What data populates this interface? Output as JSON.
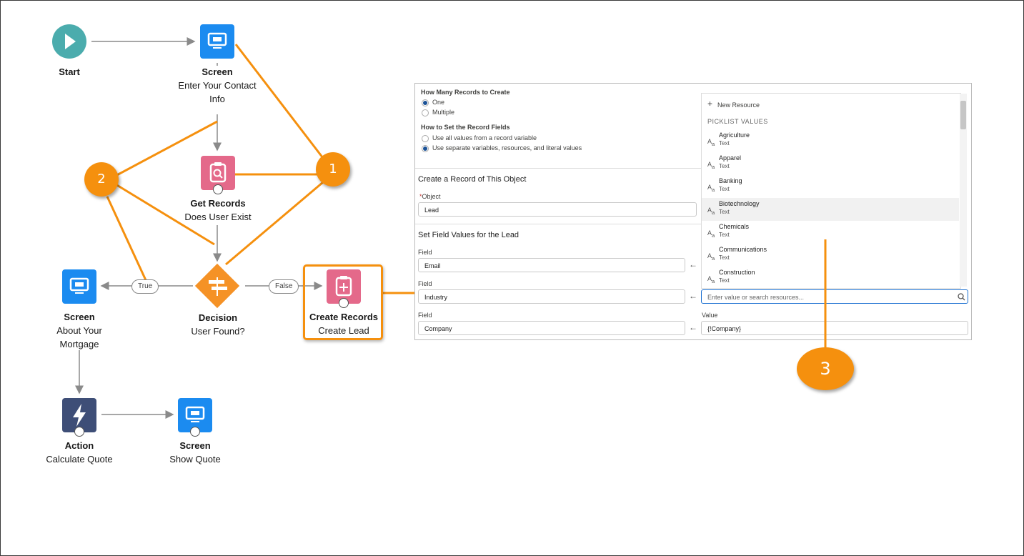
{
  "flow": {
    "start": {
      "label": "Start"
    },
    "screen_contact": {
      "type": "Screen",
      "label": "Enter Your Contact Info"
    },
    "get_records": {
      "type": "Get Records",
      "label": "Does User Exist"
    },
    "decision": {
      "type": "Decision",
      "label": "User Found?"
    },
    "screen_mortgage": {
      "type": "Screen",
      "label": "About Your Mortgage"
    },
    "create_records": {
      "type": "Create Records",
      "label": "Create Lead"
    },
    "action": {
      "type": "Action",
      "label": "Calculate Quote"
    },
    "screen_quote": {
      "type": "Screen",
      "label": "Show Quote"
    },
    "outcome_true": "True",
    "outcome_false": "False"
  },
  "badges": [
    "1",
    "2",
    "3"
  ],
  "panel": {
    "how_many_label": "How Many Records to Create",
    "opt_one": "One",
    "opt_multiple": "Multiple",
    "how_set_label": "How to Set the Record Fields",
    "opt_all_values": "Use all values from a record variable",
    "opt_separate": "Use separate variables, resources, and literal values",
    "create_section": "Create a Record of This Object",
    "object_label": "Object",
    "object_value": "Lead",
    "set_section": "Set Field Values for the Lead",
    "field_label": "Field",
    "value_label": "Value",
    "rows": [
      {
        "field": "Email"
      },
      {
        "field": "Industry",
        "value_placeholder": "Enter value or search resources..."
      },
      {
        "field": "Company",
        "value": "{!Company}"
      }
    ],
    "dropdown": {
      "new_resource": "New Resource",
      "group_label": "PICKLIST VALUES",
      "items": [
        {
          "label": "Agriculture",
          "sub": "Text"
        },
        {
          "label": "Apparel",
          "sub": "Text"
        },
        {
          "label": "Banking",
          "sub": "Text"
        },
        {
          "label": "Biotechnology",
          "sub": "Text"
        },
        {
          "label": "Chemicals",
          "sub": "Text"
        },
        {
          "label": "Communications",
          "sub": "Text"
        },
        {
          "label": "Construction",
          "sub": "Text"
        }
      ]
    }
  },
  "colors": {
    "accent_orange": "#f5900e",
    "screen_blue": "#1b8bf0",
    "records_pink": "#e4698a",
    "action_navy": "#3e4e77",
    "decision_orange": "#f59226",
    "start_teal": "#4bacad"
  }
}
